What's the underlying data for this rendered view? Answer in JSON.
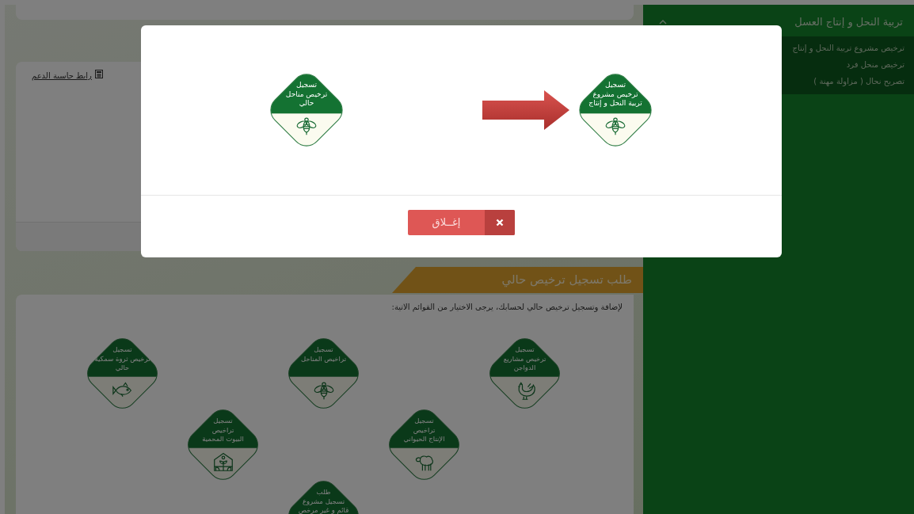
{
  "sidebar": {
    "section": {
      "title": "تربية النحل و إنتاج العسل",
      "expanded": true,
      "items": [
        {
          "label": "ترخيص مشروع تربية النحل و إنتاج"
        },
        {
          "label": "ترخيص منحل فرد"
        },
        {
          "label": "تصريح نحال ( مزاولة مهنة )"
        }
      ]
    }
  },
  "support_card": {
    "link": "رابط حاسبة الدعم"
  },
  "section_header": "طلب تسجيل ترخيص حالي",
  "instructions": "لإضافة وتسجيل ترخيص حالي لحسابك، يرجى الاختيار من القوائم الاتية:",
  "tiles": [
    {
      "title": "تسجيل\nترخيص مشاريع\nالدواجن",
      "kind": "rooster"
    },
    {
      "title": "تسجيل\nتراخيص المناحل",
      "kind": "bee"
    },
    {
      "title": "تسجيل\nترخيص ثروة سمكية\nحالي",
      "kind": "fish"
    },
    {
      "title": "تسجيل\nتراخيص\nالإنتاج الحيواني",
      "kind": "sheep"
    },
    {
      "title": "تسجيل\nتراخيص\nالبيوت المحمية",
      "kind": "greenhouse"
    },
    {
      "title": "طلب\nتسجيل مشروع\nقائم و غير مرخص"
    }
  ],
  "modal": {
    "open": true,
    "options": [
      {
        "title": "تسجيل\nترخيص مشروع\nتربية النحل و إنتاج",
        "kind": "bee",
        "pointed": true
      },
      {
        "title": "تسجيل\nترخيص مناحل\nحالي",
        "kind": "bee",
        "pointed": false
      }
    ],
    "close_button": "إغــلاق"
  }
}
